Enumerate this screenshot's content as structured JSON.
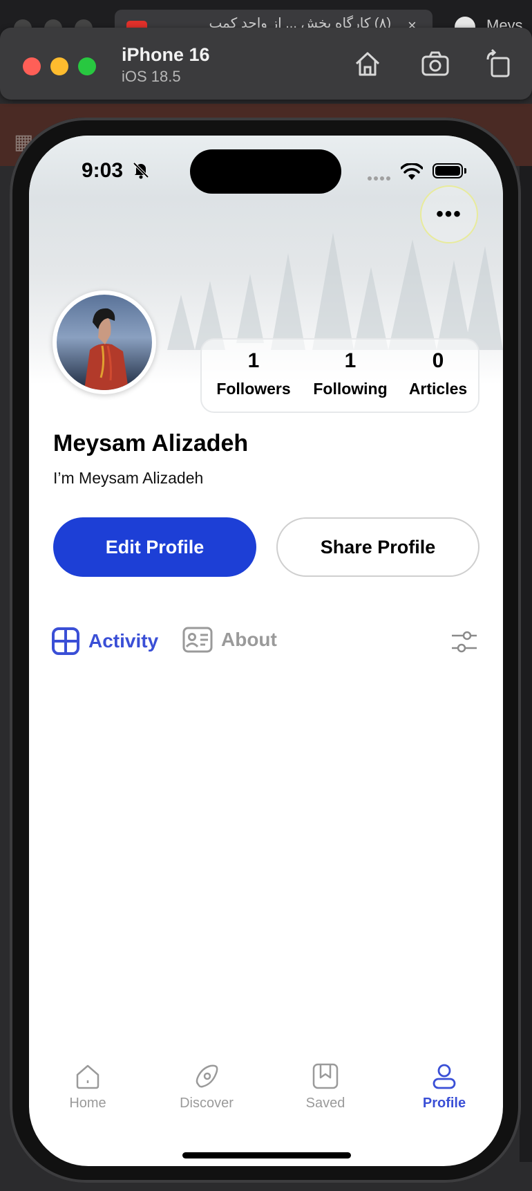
{
  "background": {
    "tab_title": "(۸) کارگاه بخش ... از واحد کمپ",
    "tab_close": "×",
    "github_label": "Meys"
  },
  "simulator": {
    "device_name": "iPhone 16",
    "os_version": "iOS 18.5"
  },
  "status_bar": {
    "time": "9:03"
  },
  "header": {
    "more_button": "•••"
  },
  "profile": {
    "name": "Meysam Alizadeh",
    "bio": "I’m Meysam Alizadeh",
    "stats": [
      {
        "value": "1",
        "label": "Followers"
      },
      {
        "value": "1",
        "label": "Following"
      },
      {
        "value": "0",
        "label": "Articles"
      }
    ]
  },
  "actions": {
    "edit_label": "Edit Profile",
    "share_label": "Share Profile"
  },
  "tabs": {
    "activity": "Activity",
    "about": "About",
    "selected": "Activity"
  },
  "bottom_nav": {
    "items": [
      {
        "label": "Home",
        "icon": "home-icon"
      },
      {
        "label": "Discover",
        "icon": "compass-icon"
      },
      {
        "label": "Saved",
        "icon": "bookmark-icon"
      },
      {
        "label": "Profile",
        "icon": "person-icon"
      }
    ],
    "active": "Profile"
  },
  "colors": {
    "accent": "#1d3fd6",
    "tab_active": "#3a4fd6",
    "inactive": "#9a9a9a"
  }
}
